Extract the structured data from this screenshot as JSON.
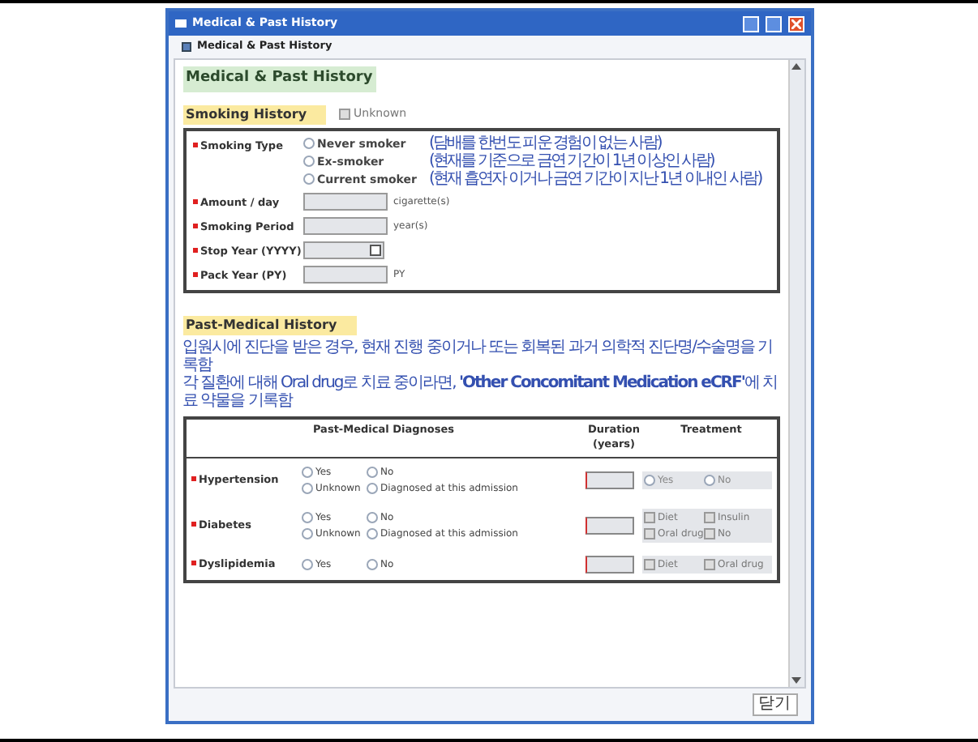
{
  "window": {
    "title": "Medical & Past History"
  },
  "toolbar": {
    "title": "Medical & Past History"
  },
  "page_heading": "Medical & Past History",
  "smoking": {
    "heading": "Smoking History",
    "unknown": {
      "label": "Unknown",
      "checked": false
    },
    "fields": [
      {
        "kind": "radio",
        "label": "Smoking Type",
        "options": [
          {
            "label": "Never smoker",
            "note": "(담배를 한번도 피운 경험이 없는 사람)",
            "selected": false
          },
          {
            "label": "Ex-smoker",
            "note": "(현재를 기준으로 금연 기간이 1년 이상인 사람)",
            "selected": false
          },
          {
            "label": "Current smoker",
            "note": "(현재 흡연자 이거나 금연 기간이 지난 1년 이내인 사람)",
            "selected": false
          }
        ]
      },
      {
        "kind": "text",
        "label": "Amount / day",
        "unit": "cigarette(s)"
      },
      {
        "kind": "text",
        "label": "Smoking Period",
        "unit": "year(s)"
      },
      {
        "kind": "date",
        "label": "Stop Year (YYYY)"
      },
      {
        "kind": "text",
        "label": "Pack Year (PY)",
        "unit": "PY"
      }
    ]
  },
  "past_medical": {
    "heading": "Past-Medical History",
    "notes": [
      "입원시에 진단을 받은 경우, 현재 진행 중이거나 또는 회복된 과거 의학적 진단명/수술명을 기록함",
      "각 질환에 대해 Oral drug로 치료 중이라면, **'Other Concomitant Medication eCRF'**에 치료 약물을 기록함"
    ],
    "columns": [
      "Past-Medical Diagnoses",
      "Duration (years)",
      "Treatment"
    ],
    "rows": [
      {
        "label": "Hypertension",
        "status": [
          {
            "label": "Yes",
            "selected": false
          },
          {
            "label": "No",
            "selected": false
          },
          {
            "label": "Unknown",
            "selected": false
          },
          {
            "label": "Diagnosed at this admission",
            "selected": false
          }
        ],
        "treatment": {
          "kind": "radio",
          "disabled": true,
          "options": [
            {
              "label": "Yes",
              "selected": false
            },
            {
              "label": "No",
              "selected": false
            }
          ]
        }
      },
      {
        "label": "Diabetes",
        "status": [
          {
            "label": "Yes",
            "selected": false
          },
          {
            "label": "No",
            "selected": false
          },
          {
            "label": "Unknown",
            "selected": false
          },
          {
            "label": "Diagnosed at this admission",
            "selected": false
          }
        ],
        "treatment": {
          "kind": "checkbox",
          "disabled": true,
          "options": [
            {
              "label": "Diet",
              "selected": false
            },
            {
              "label": "Insulin",
              "selected": false
            },
            {
              "label": "Oral drug",
              "selected": false
            },
            {
              "label": "No",
              "selected": false
            }
          ]
        }
      },
      {
        "label": "Dyslipidemia",
        "status": [
          {
            "label": "Yes",
            "selected": false
          },
          {
            "label": "No",
            "selected": false
          }
        ],
        "treatment": {
          "kind": "checkbox",
          "disabled": true,
          "options": [
            {
              "label": "Diet",
              "selected": false
            },
            {
              "label": "Oral drug",
              "selected": false
            }
          ]
        }
      }
    ]
  },
  "close_button": "닫기"
}
